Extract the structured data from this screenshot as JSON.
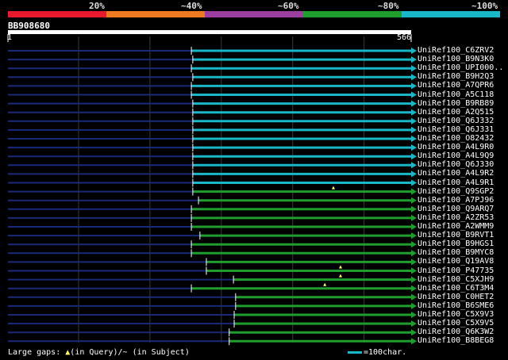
{
  "legend": {
    "labels": [
      "20%",
      "~40%",
      "~60%",
      "~80%",
      "~100%"
    ],
    "colors": [
      "#e8192c",
      "#ee7a22",
      "#9b3ea0",
      "#1f9e2e",
      "#18b8c8"
    ]
  },
  "query": {
    "id": "BB908680",
    "start": "1",
    "end": "566",
    "length": 566
  },
  "hits": [
    {
      "name": "UniRef100_C6ZRV2",
      "start": 1,
      "end": 566,
      "hit_start": 258,
      "color": "cyan",
      "gap": null
    },
    {
      "name": "UniRef100_B9N3K0",
      "start": 1,
      "end": 566,
      "hit_start": 260,
      "color": "cyan",
      "gap": null
    },
    {
      "name": "UniRef100_UPI000..",
      "start": 1,
      "end": 566,
      "hit_start": 258,
      "color": "cyan",
      "gap": null
    },
    {
      "name": "UniRef100_B9H2Q3",
      "start": 1,
      "end": 566,
      "hit_start": 260,
      "color": "cyan",
      "gap": null
    },
    {
      "name": "UniRef100_A7QPR6",
      "start": 1,
      "end": 566,
      "hit_start": 258,
      "color": "cyan",
      "gap": null
    },
    {
      "name": "UniRef100_A5C118",
      "start": 1,
      "end": 566,
      "hit_start": 258,
      "color": "cyan",
      "gap": null
    },
    {
      "name": "UniRef100_B9RB89",
      "start": 1,
      "end": 566,
      "hit_start": 260,
      "color": "cyan",
      "gap": null
    },
    {
      "name": "UniRef100_A2Q515",
      "start": 1,
      "end": 566,
      "hit_start": 260,
      "color": "cyan",
      "gap": null
    },
    {
      "name": "UniRef100_Q6J332",
      "start": 1,
      "end": 566,
      "hit_start": 260,
      "color": "cyan",
      "gap": null
    },
    {
      "name": "UniRef100_Q6J331",
      "start": 1,
      "end": 566,
      "hit_start": 260,
      "color": "cyan",
      "gap": null
    },
    {
      "name": "UniRef100_O82432",
      "start": 1,
      "end": 566,
      "hit_start": 260,
      "color": "cyan",
      "gap": null
    },
    {
      "name": "UniRef100_A4L9R0",
      "start": 1,
      "end": 566,
      "hit_start": 260,
      "color": "cyan",
      "gap": null
    },
    {
      "name": "UniRef100_A4L9Q9",
      "start": 1,
      "end": 566,
      "hit_start": 260,
      "color": "cyan",
      "gap": null
    },
    {
      "name": "UniRef100_Q6J330",
      "start": 1,
      "end": 566,
      "hit_start": 260,
      "color": "cyan",
      "gap": null
    },
    {
      "name": "UniRef100_A4L9R2",
      "start": 1,
      "end": 566,
      "hit_start": 260,
      "color": "cyan",
      "gap": null
    },
    {
      "name": "UniRef100_A4L9R1",
      "start": 1,
      "end": 566,
      "hit_start": 260,
      "color": "cyan",
      "gap": null
    },
    {
      "name": "UniRef100_Q9SGP2",
      "start": 1,
      "end": 566,
      "hit_start": 260,
      "color": "green",
      "gap": 457
    },
    {
      "name": "UniRef100_A7PJ96",
      "start": 1,
      "end": 566,
      "hit_start": 268,
      "color": "green",
      "gap": null
    },
    {
      "name": "UniRef100_Q9ARQ7",
      "start": 1,
      "end": 566,
      "hit_start": 258,
      "color": "green",
      "gap": null
    },
    {
      "name": "UniRef100_A2ZR53",
      "start": 1,
      "end": 566,
      "hit_start": 258,
      "color": "green",
      "gap": null
    },
    {
      "name": "UniRef100_A2WMM9",
      "start": 1,
      "end": 566,
      "hit_start": 258,
      "color": "green",
      "gap": null
    },
    {
      "name": "UniRef100_B9RVT1",
      "start": 1,
      "end": 566,
      "hit_start": 270,
      "color": "green",
      "gap": null
    },
    {
      "name": "UniRef100_B9HGS1",
      "start": 1,
      "end": 566,
      "hit_start": 258,
      "color": "green",
      "gap": null
    },
    {
      "name": "UniRef100_B9MYC8",
      "start": 1,
      "end": 566,
      "hit_start": 258,
      "color": "green",
      "gap": null
    },
    {
      "name": "UniRef100_Q19AV8",
      "start": 1,
      "end": 566,
      "hit_start": 279,
      "color": "green",
      "gap": null
    },
    {
      "name": "UniRef100_P47735",
      "start": 1,
      "end": 566,
      "hit_start": 279,
      "color": "green",
      "gap": 467
    },
    {
      "name": "UniRef100_C5XJH9",
      "start": 1,
      "end": 566,
      "hit_start": 317,
      "color": "green",
      "gap": 467
    },
    {
      "name": "UniRef100_C6T3M4",
      "start": 1,
      "end": 566,
      "hit_start": 258,
      "color": "green",
      "gap": 445
    },
    {
      "name": "UniRef100_C0HET2",
      "start": 1,
      "end": 566,
      "hit_start": 320,
      "color": "green",
      "gap": null
    },
    {
      "name": "UniRef100_B6SME6",
      "start": 1,
      "end": 566,
      "hit_start": 320,
      "color": "green",
      "gap": null
    },
    {
      "name": "UniRef100_C5X9V3",
      "start": 1,
      "end": 566,
      "hit_start": 318,
      "color": "green",
      "gap": null
    },
    {
      "name": "UniRef100_C5X9V5",
      "start": 1,
      "end": 566,
      "hit_start": 318,
      "color": "green",
      "gap": null
    },
    {
      "name": "UniRef100_Q6K3W2",
      "start": 1,
      "end": 566,
      "hit_start": 311,
      "color": "green",
      "gap": null
    },
    {
      "name": "UniRef100_B8BEG8",
      "start": 1,
      "end": 566,
      "hit_start": 311,
      "color": "green",
      "gap": null
    }
  ],
  "footer": {
    "gaps_prefix": "Large gaps:",
    "gaps_query": "(in Query)/",
    "gaps_subject": "(in Subject)",
    "scale_label": "=100char."
  }
}
